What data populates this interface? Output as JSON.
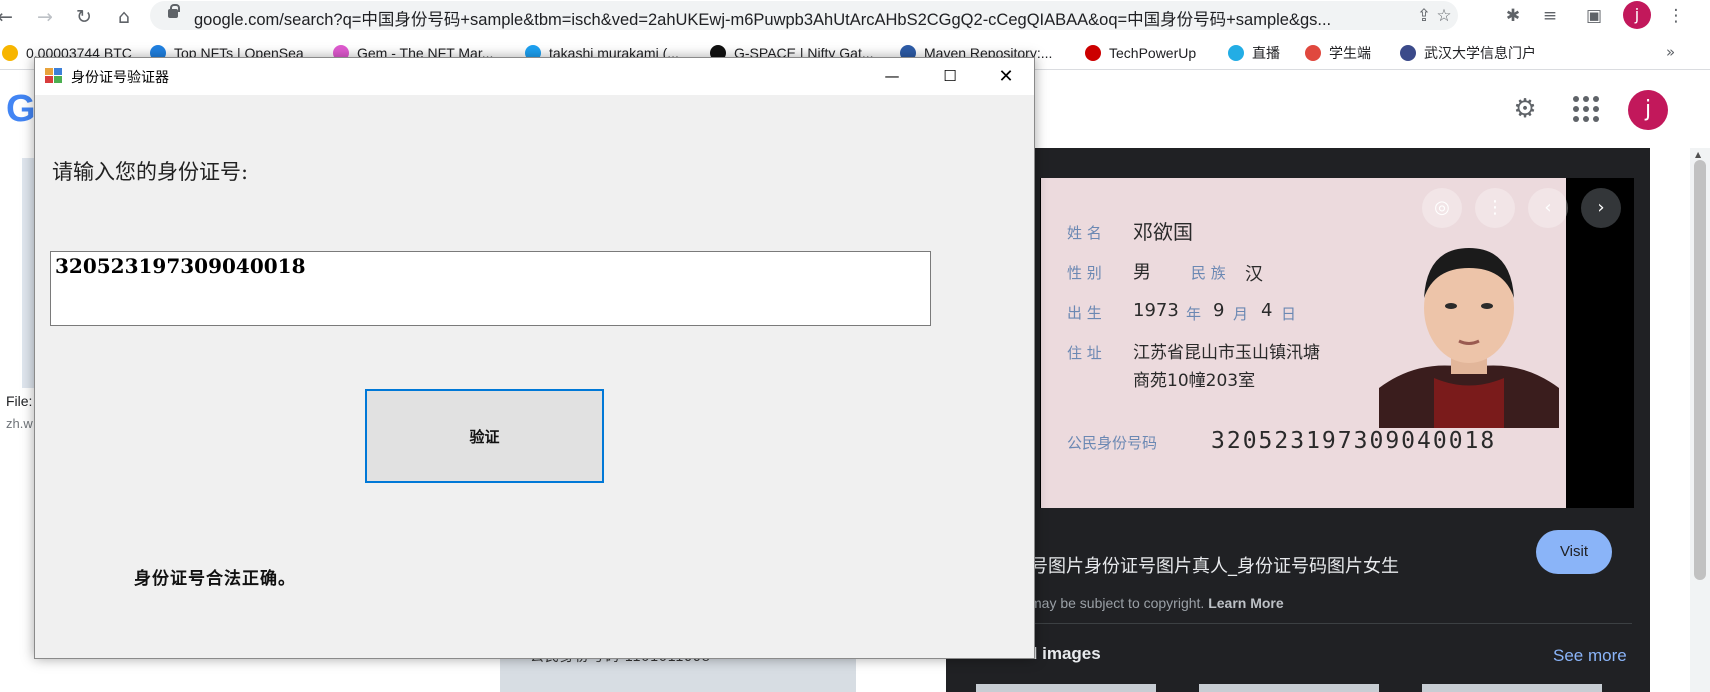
{
  "browser": {
    "url": "google.com/search?q=中国身份号码+sample&tbm=isch&ved=2ahUKEwj-m6Puwpb3AhUtArcAHbS2CGgQ2-cCegQIABAA&oq=中国身份号码+sample&gs...",
    "profile_initial": "j",
    "bookmarks": [
      {
        "label": "0.00003744 BTC",
        "icon_color": "#f7b500"
      },
      {
        "label": "Top NFTs | OpenSea",
        "icon_color": "#2081e2"
      },
      {
        "label": "Gem - The NFT Mar...",
        "icon_color": "#e05ad0"
      },
      {
        "label": "takashi murakami (...",
        "icon_color": "#1da1f2"
      },
      {
        "label": "G-SPACE | Nifty Gat...",
        "icon_color": "#111111"
      },
      {
        "label": "Maven Repository:...",
        "icon_color": "#2d5ca8"
      },
      {
        "label": "TechPowerUp",
        "icon_color": "#cc0000"
      },
      {
        "label": "直播",
        "icon_color": "#23ade5"
      },
      {
        "label": "学生端",
        "icon_color": "#e0483e"
      },
      {
        "label": "武汉大学信息门户",
        "icon_color": "#3b4a8a"
      }
    ],
    "bookmarks_more": "»"
  },
  "google": {
    "logo_letter": "G",
    "profile_initial": "j",
    "file_text": "File:",
    "file_source": "zh.w",
    "thumb_text": "公民身份号码  1101011998"
  },
  "viewer": {
    "card": {
      "name_label": "姓 名",
      "name": "邓欲国",
      "sex_label": "性 别",
      "sex": "男",
      "ethnic_label": "民 族",
      "ethnic": "汉",
      "birth_label": "出 生",
      "birth_year": "1973",
      "year_label": "年",
      "birth_month": "9",
      "month_label": "月",
      "birth_day": "4",
      "day_label": "日",
      "address_label": "住 址",
      "address_line1": "江苏省昆山市玉山镇汛塘",
      "address_line2": "商苑10幢203室",
      "id_label": "公民身份号码",
      "id_number": "320523197309040018"
    },
    "caption": "号图片身份证号图片真人_身份证号码图片女生",
    "copyright_text": "may be subject to copyright.",
    "learn_more": "Learn More",
    "visit_label": "Visit",
    "related_label": "Related images",
    "see_more_label": "See more"
  },
  "dialog": {
    "title": "身份证号验证器",
    "prompt": "请输入您的身份证号:",
    "input_value": "320523197309040018",
    "verify_label": "验证",
    "result_text": "身份证号合法正确。"
  }
}
